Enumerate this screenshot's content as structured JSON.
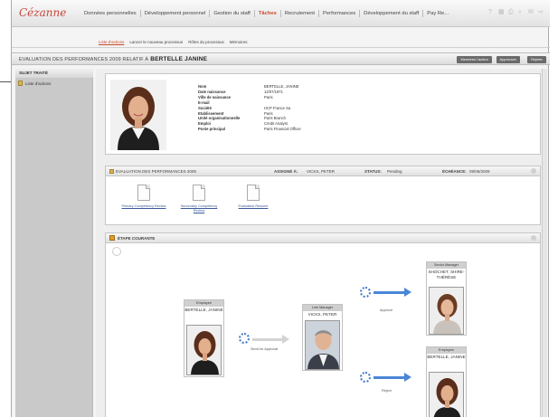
{
  "app": {
    "logo": "Cézanne",
    "nav": [
      "Données personnelles",
      "Développement personnel",
      "Gestion du staff",
      "Tâches",
      "Recrutement",
      "Performances",
      "Développement du staff",
      "Pay Re..."
    ],
    "active_nav_index": 3,
    "subnav": [
      "Liste d'actions",
      "Lancer le nouveau processus",
      "Rôles du processus",
      "Mémoires"
    ]
  },
  "title": {
    "prefix": "Evaluation des performances 2009 relatif à",
    "person": "BERTELLE JANINE",
    "buttons": [
      "Membres l'acteur",
      "Approuver",
      "Rejeter"
    ]
  },
  "sidebar": {
    "header": "Sujet traité",
    "items": [
      "Liste d'actions"
    ]
  },
  "profile": {
    "fields": [
      {
        "k": "Nom",
        "v": "BERTELLE, JANINE"
      },
      {
        "k": "Date naissance",
        "v": "12/07/1971"
      },
      {
        "k": "Ville de naissance",
        "v": "Paris"
      },
      {
        "k": "E-mail",
        "v": ""
      },
      {
        "k": "Société",
        "v": "HCP France Sa"
      },
      {
        "k": "Etablissement",
        "v": "Paris"
      },
      {
        "k": "Unité organisationnelle",
        "v": "Paris Branch"
      },
      {
        "k": "Emploi",
        "v": "Credit Analyst"
      },
      {
        "k": "Poste principal",
        "v": "Paris Financial Officer"
      }
    ]
  },
  "evaluation": {
    "title": "Evaluation des performances 2009",
    "assigned_label": "Assigné à:",
    "assigned_value": "VICKS, PETER",
    "status_label": "Status:",
    "status_value": "Pending",
    "due_label": "Échéance:",
    "due_value": "09/06/2009",
    "docs": [
      "Primary Competency Review",
      "Secondary Competency Review",
      "Evaluation Resume"
    ]
  },
  "step": {
    "title": "Étape courante",
    "cards": {
      "employee": {
        "role": "Employee",
        "name": "BERTELLE, JANINE"
      },
      "line_manager": {
        "role": "Line Manager",
        "name": "VICKS, PETER"
      },
      "senior_manager": {
        "role": "Senior Manager",
        "name": "SHOCHET, SHIRE-THÉRÈSE"
      },
      "employee2": {
        "role": "Employee",
        "name": "BERTELLE, JANINE"
      }
    },
    "labels": {
      "send": "Send for Approval",
      "approve": "Approve",
      "reject": "Reject"
    }
  }
}
